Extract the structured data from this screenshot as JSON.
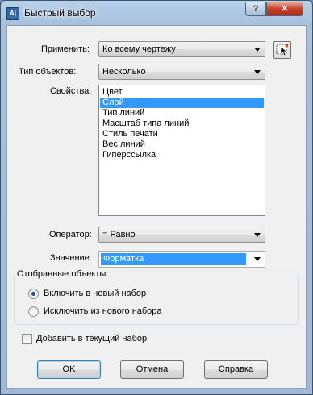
{
  "window": {
    "title": "Быстрый выбор",
    "app_icon_text": "A|",
    "help_button_label": "?",
    "close_button_label": "✕"
  },
  "apply": {
    "label": "Применить:",
    "value": "Ко всему чертежу"
  },
  "object_type": {
    "label": "Тип объектов:",
    "value": "Несколько"
  },
  "properties": {
    "label": "Свойства:",
    "items": [
      "Цвет",
      "Слой",
      "Тип линий",
      "Масштаб типа линий",
      "Стиль печати",
      "Вес линий",
      "Гиперссылка"
    ],
    "selected_index": 1
  },
  "operator": {
    "label": "Оператор:",
    "value": "= Равно"
  },
  "value": {
    "label": "Значение:",
    "value": "Форматка"
  },
  "selection_group": {
    "title": "Отобранные объекты:",
    "include_label": "Включить в новый набор",
    "exclude_label": "Исключить из нового набора",
    "selected": "include"
  },
  "append_checkbox": {
    "label": "Добавить в текущий набор",
    "checked": false
  },
  "buttons": {
    "ok": "OK",
    "cancel": "Отмена",
    "help": "Справка"
  }
}
